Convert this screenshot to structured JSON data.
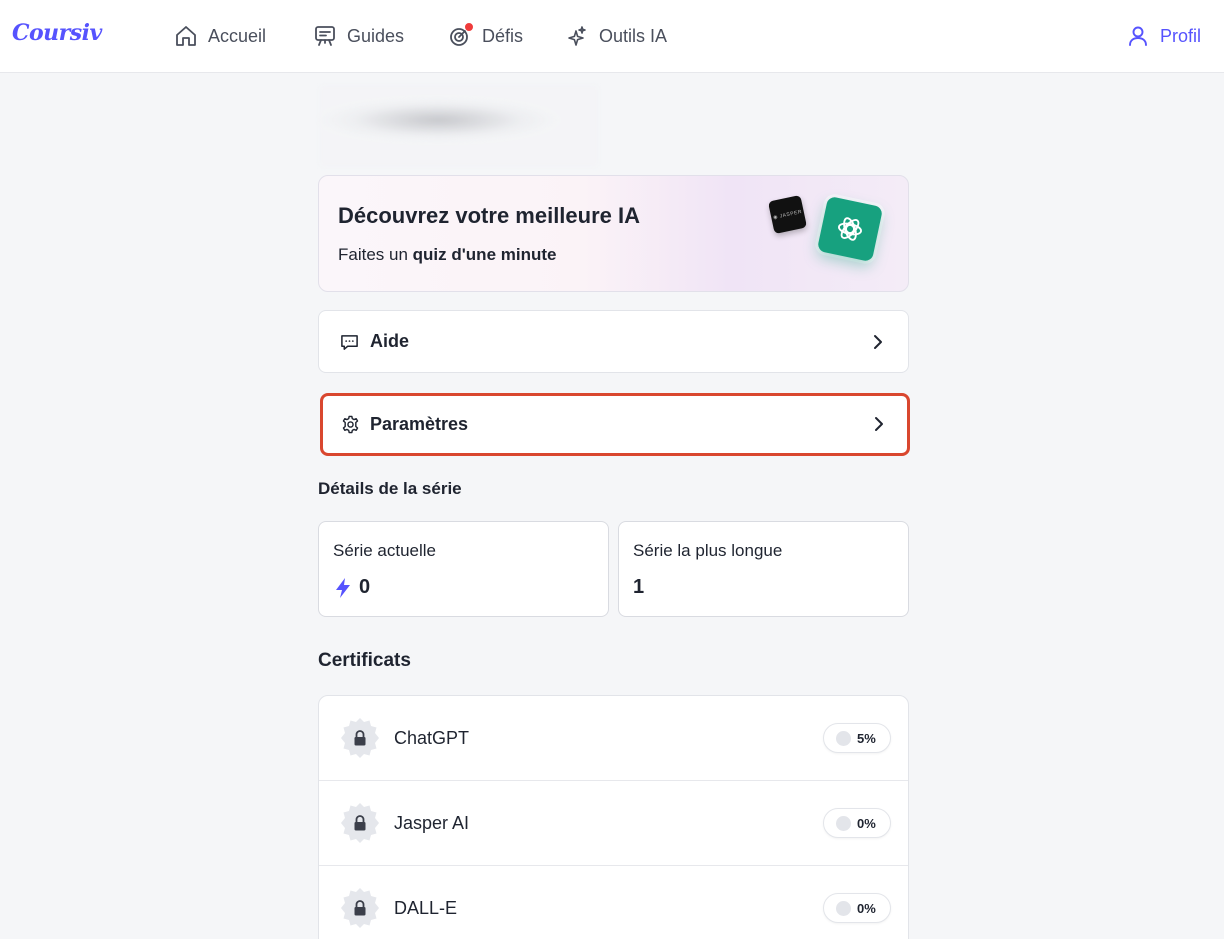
{
  "app": {
    "logo_text": "Coursiv"
  },
  "nav": {
    "items": [
      {
        "label": "Accueil",
        "icon": "home-icon"
      },
      {
        "label": "Guides",
        "icon": "presentation-board-icon"
      },
      {
        "label": "Défis",
        "icon": "target-icon",
        "has_notification_dot": true
      },
      {
        "label": "Outils IA",
        "icon": "sparkle-icon"
      }
    ],
    "profile_label": "Profil"
  },
  "colors": {
    "brand": "#5653fe",
    "focus_outline": "#d9472f",
    "notification": "#ef3b3b",
    "chatgpt_green": "#17a17f"
  },
  "promo": {
    "title": "Découvrez votre meilleure IA",
    "subtitle_prefix": "Faites un ",
    "subtitle_bold": "quiz d'une minute"
  },
  "menu": {
    "aide": "Aide",
    "parametres": "Paramètres"
  },
  "streak": {
    "section_title": "Détails de la série",
    "current_label": "Série actuelle",
    "current_value": "0",
    "longest_label": "Série la plus longue",
    "longest_value": "1"
  },
  "certificates": {
    "section_title": "Certificats",
    "items": [
      {
        "name": "ChatGPT",
        "progress": "5%",
        "locked": true
      },
      {
        "name": "Jasper AI",
        "progress": "0%",
        "locked": true
      },
      {
        "name": "DALL-E",
        "progress": "0%",
        "locked": true
      }
    ]
  }
}
